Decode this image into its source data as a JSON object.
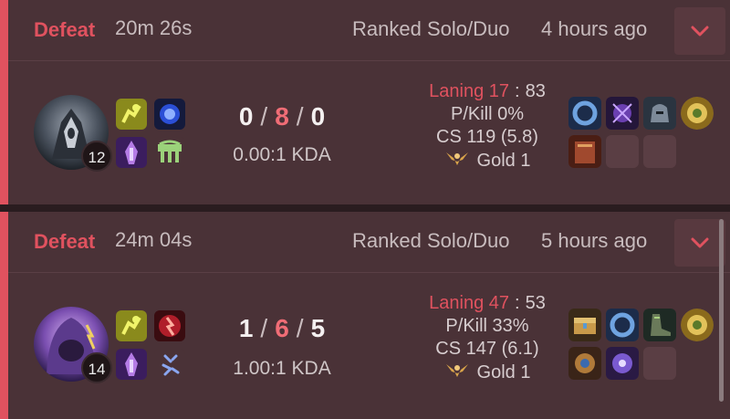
{
  "matches": [
    {
      "result": "Defeat",
      "duration": "20m 26s",
      "queue": "Ranked Solo/Duo",
      "time_ago": "4 hours ago",
      "champion_icon": "dark-armored-champion-portrait",
      "level": "12",
      "kills": "0",
      "deaths": "8",
      "assists": "0",
      "kda_ratio": "0.00:1 KDA",
      "laning_label": "Laning 17",
      "laning_sep": ":",
      "laning_value": "83",
      "pkill": "P/Kill 0%",
      "cs": "CS 119 (5.8)",
      "rank": "Gold 1",
      "summoner_spells": [
        "ghost-spell-icon",
        "cleanse-spell-icon"
      ],
      "runes": [
        "keystone-rune-icon",
        "resolve-tree-icon"
      ],
      "items": [
        "ring-item-icon",
        "dark-orb-item-icon",
        "helmet-item-icon",
        "gold-ward-trinket-icon",
        "tome-item-icon",
        "",
        ""
      ]
    },
    {
      "result": "Defeat",
      "duration": "24m 04s",
      "queue": "Ranked Solo/Duo",
      "time_ago": "5 hours ago",
      "champion_icon": "purple-hooded-champion-portrait",
      "level": "14",
      "kills": "1",
      "deaths": "6",
      "assists": "5",
      "kda_ratio": "1.00:1 KDA",
      "laning_label": "Laning 47",
      "laning_sep": ":",
      "laning_value": "53",
      "pkill": "P/Kill 33%",
      "cs": "CS 147 (6.1)",
      "rank": "Gold 1",
      "summoner_spells": [
        "ghost-spell-icon",
        "ignite-spell-icon"
      ],
      "runes": [
        "keystone-rune-icon",
        "sorcery-tree-icon"
      ],
      "items": [
        "golden-chest-item-icon",
        "ring-item-icon",
        "boots-item-icon",
        "gold-ward-trinket-icon",
        "gear-orb-item-icon",
        "violet-orb-item-icon",
        ""
      ]
    }
  ],
  "colors": {
    "defeat": "#e0525f",
    "card_bg": "#4a3237",
    "page_bg": "#2a1c1f"
  }
}
